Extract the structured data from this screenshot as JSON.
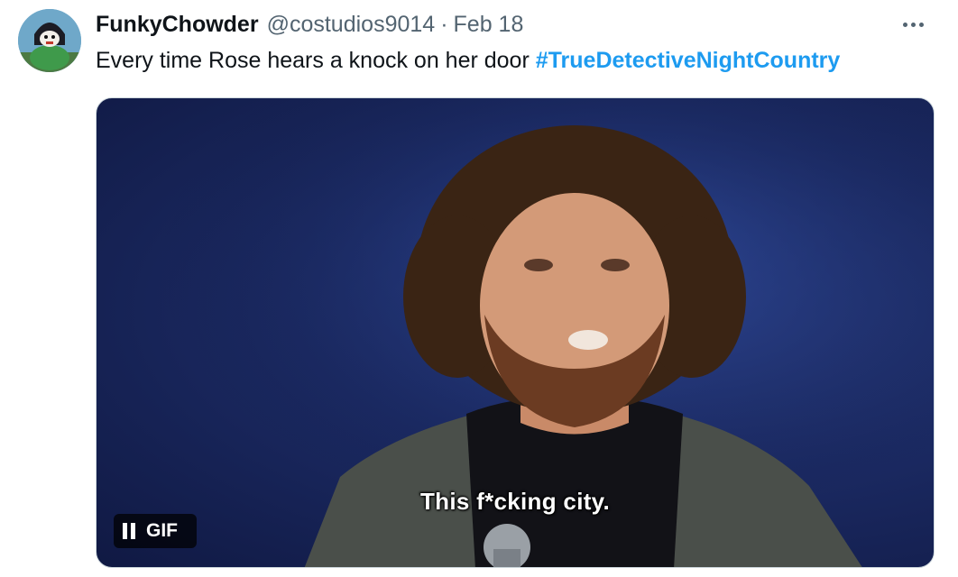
{
  "tweet": {
    "display_name": "FunkyChowder",
    "handle": "@costudios9014",
    "separator": "·",
    "date": "Feb 18",
    "text": "Every time Rose hears a knock on her door",
    "hashtag": "#TrueDetectiveNightCountry"
  },
  "media": {
    "caption": "This f*cking city.",
    "badge_label": "GIF",
    "pause_icon": "pause-icon"
  },
  "icons": {
    "more": "more-options-icon"
  },
  "colors": {
    "hashtag": "#1d9bf0",
    "secondary_text": "#536471",
    "media_background": "#1b2a63"
  }
}
